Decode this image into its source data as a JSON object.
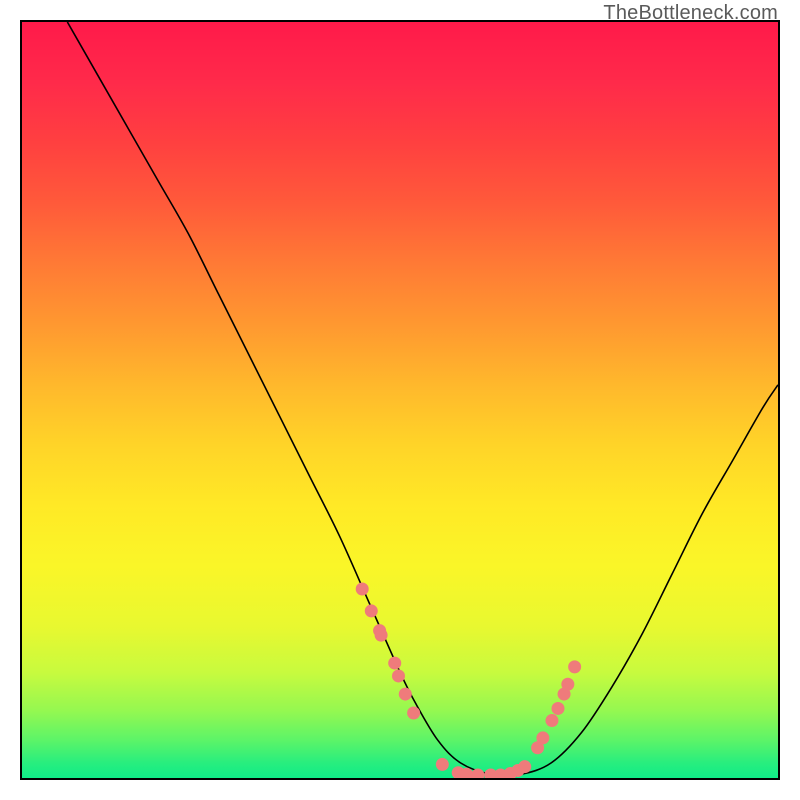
{
  "attribution": "TheBottleneck.com",
  "chart_data": {
    "type": "line",
    "title": "",
    "xlabel": "",
    "ylabel": "",
    "xlim": [
      0,
      100
    ],
    "ylim": [
      0,
      100
    ],
    "grid": false,
    "legend": false,
    "series": [
      {
        "name": "curve",
        "color": "#000000",
        "x": [
          6,
          10,
          14,
          18,
          22,
          26,
          30,
          34,
          38,
          42,
          46,
          50,
          52,
          55,
          58,
          62,
          66,
          70,
          74,
          78,
          82,
          86,
          90,
          94,
          98,
          100
        ],
        "y": [
          100,
          93,
          86,
          79,
          72,
          64,
          56,
          48,
          40,
          32,
          23,
          14,
          10,
          5,
          2,
          0.5,
          0.5,
          2,
          6,
          12,
          19,
          27,
          35,
          42,
          49,
          52
        ]
      },
      {
        "name": "left-cluster-markers",
        "type": "scatter",
        "color": "#ef7b7b",
        "x": [
          45.0,
          46.2,
          47.3,
          47.5,
          49.3,
          49.8,
          50.7,
          51.8
        ],
        "y": [
          25.0,
          22.1,
          19.5,
          18.9,
          15.2,
          13.5,
          11.1,
          8.6
        ]
      },
      {
        "name": "bottom-cluster-markers",
        "type": "scatter",
        "color": "#ef7b7b",
        "x": [
          55.6,
          57.7,
          58.8,
          60.3,
          62.0,
          63.3,
          64.6,
          65.6,
          66.5
        ],
        "y": [
          1.8,
          0.7,
          0.5,
          0.4,
          0.4,
          0.4,
          0.6,
          1.0,
          1.5
        ]
      },
      {
        "name": "right-cluster-markers",
        "type": "scatter",
        "color": "#ef7b7b",
        "x": [
          68.2,
          68.9,
          70.1,
          70.9,
          71.7,
          72.2,
          73.1
        ],
        "y": [
          4.0,
          5.3,
          7.6,
          9.2,
          11.1,
          12.4,
          14.7
        ]
      }
    ]
  }
}
